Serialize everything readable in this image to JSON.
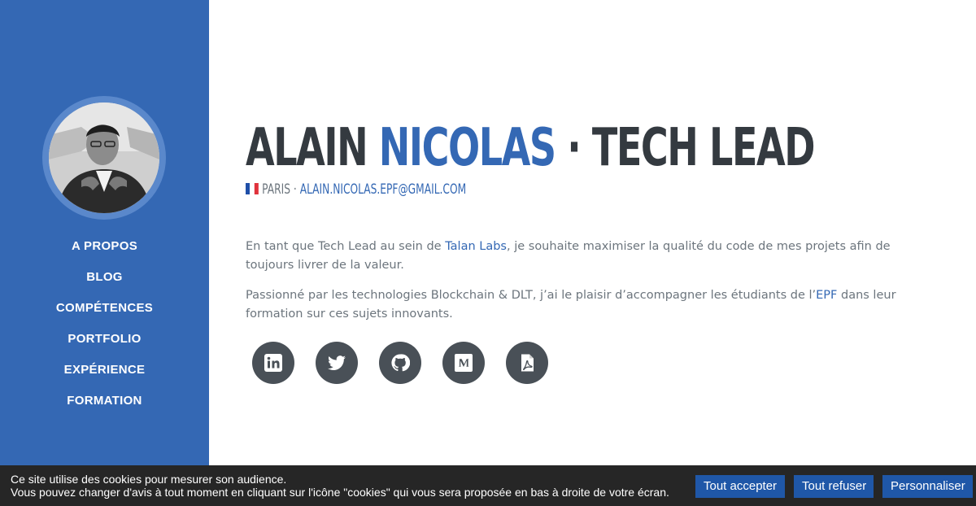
{
  "colors": {
    "primary": "#3468b4",
    "primary_light": "#5a88cb",
    "heading": "#343a40",
    "text": "#6c757d",
    "social_bg": "#495057",
    "cookie_bg": "#262626",
    "cookie_button": "#1f57a8"
  },
  "sidebar": {
    "avatar_alt": "profile-photo",
    "nav": [
      {
        "label": "A PROPOS"
      },
      {
        "label": "BLOG"
      },
      {
        "label": "COMPÉTENCES"
      },
      {
        "label": "PORTFOLIO"
      },
      {
        "label": "EXPÉRIENCE"
      },
      {
        "label": "FORMATION"
      }
    ]
  },
  "header": {
    "first_name": "ALAIN",
    "last_name": "NICOLAS",
    "separator": " · ",
    "role": "TECH LEAD",
    "city": "PARIS",
    "dot": " · ",
    "email": "ALAIN.NICOLAS.EPF@GMAIL.COM"
  },
  "about": {
    "p1_before": "En tant que Tech Lead au sein de ",
    "p1_link": "Talan Labs",
    "p1_after": ", je souhaite maximiser la qualité du code de mes projets afin de toujours livrer de la valeur.",
    "p2_before": "Passionné par les technologies Blockchain & DLT, j’ai le plaisir d’accompagner les étudiants de l’",
    "p2_link": "EPF",
    "p2_after": " dans leur formation sur ces sujets innovants."
  },
  "socials": [
    {
      "icon": "linkedin-icon"
    },
    {
      "icon": "twitter-icon"
    },
    {
      "icon": "github-icon"
    },
    {
      "icon": "medium-icon"
    },
    {
      "icon": "pdf-icon"
    }
  ],
  "cookie": {
    "line1": "Ce site utilise des cookies pour mesurer son audience.",
    "line2": "Vous pouvez changer d'avis à tout moment en cliquant sur l'icône \"cookies\" qui vous sera proposée en bas à droite de votre écran.",
    "accept_label": "Tout accepter",
    "refuse_label": "Tout refuser",
    "customize_label": "Personnaliser"
  }
}
